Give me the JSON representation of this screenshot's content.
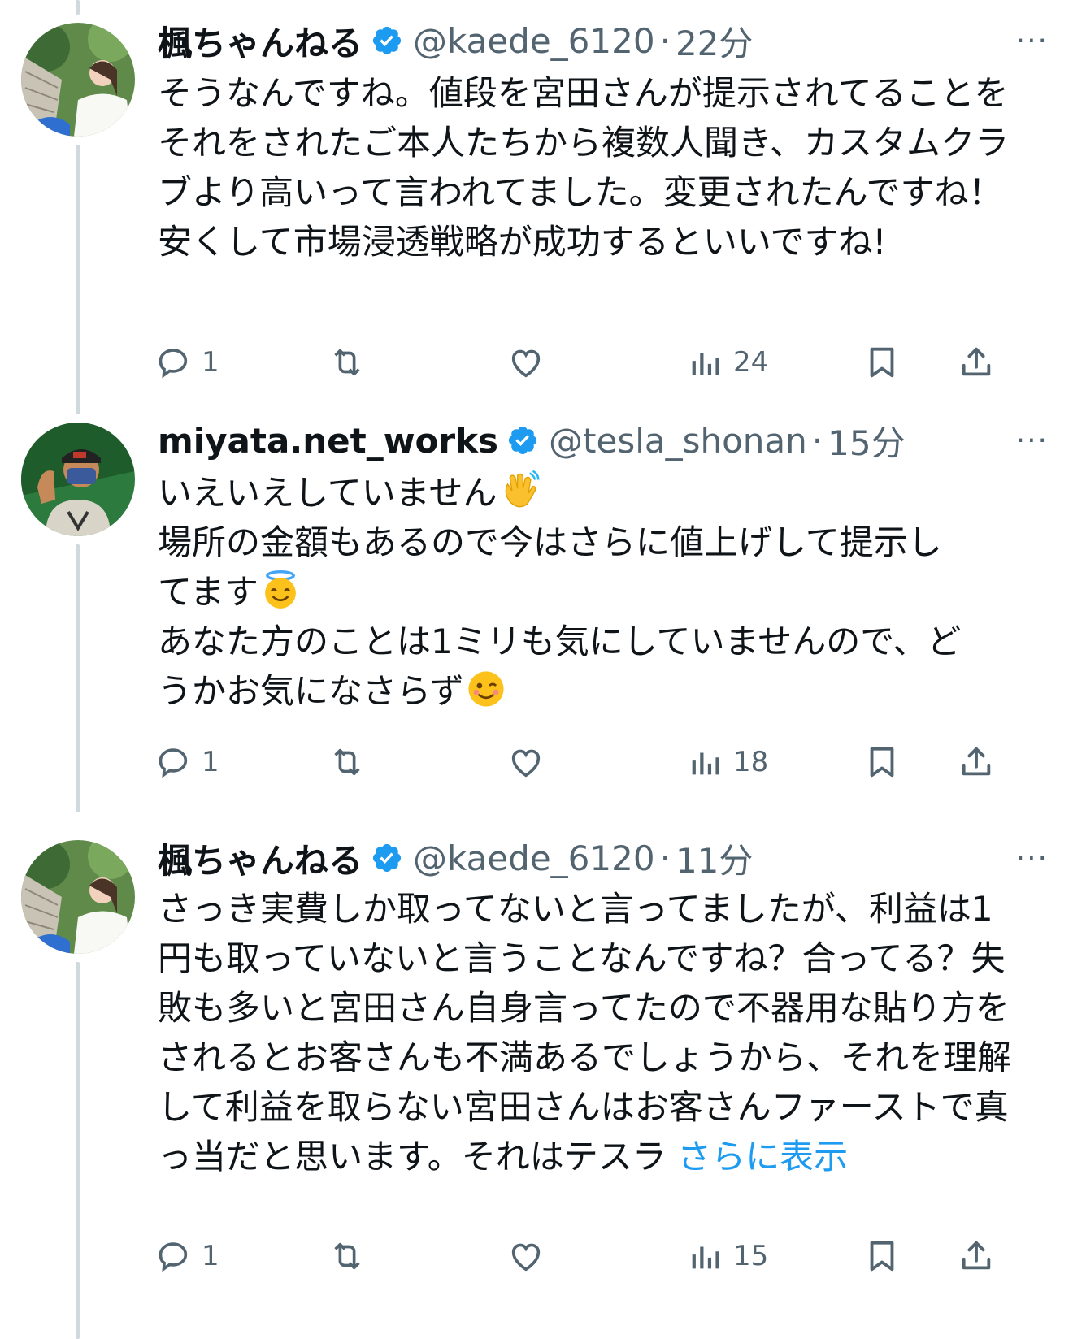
{
  "tweets": [
    {
      "name": "楓ちゃんねる",
      "handle": "@kaede_6120",
      "sep": "·",
      "time": "22分",
      "text": "そうなんですね。値段を宮田さんが提示されてることをそれをされたご本人たちから複数人聞き、カスタムクラブより高いって言われてました。変更されたんですね！安くして市場浸透戦略が成功するといいですね!",
      "replies": "1",
      "views": "24",
      "avatar": "woman-in-garden"
    },
    {
      "name": "miyata.net_works",
      "handle": "@tesla_shonan",
      "sep": "·",
      "time": "15分",
      "lines": [
        "いえいえしていません",
        "場所の金額もあるので今はさらに値上げして提示し",
        "てます",
        "あなた方のことは1ミリも気にしていませんので、ど",
        "うかお気になさらず"
      ],
      "emojis": [
        "waving-hand",
        "smiling-face-with-halo",
        "winking-face"
      ],
      "replies": "1",
      "views": "18",
      "avatar": "masked-man-cartoon"
    },
    {
      "name": "楓ちゃんねる",
      "handle": "@kaede_6120",
      "sep": "·",
      "time": "11分",
      "text": "さっき実費しか取ってないと言ってましたが、利益は1円も取っていないと言うことなんですね？合ってる？失敗も多いと宮田さん自身言ってたので不器用な貼り方をされるとお客さんも不満あるでしょうから、それを理解して利益を取らない宮田さんはお客さんファーストで真っ当だと思います。それはテスラ",
      "show_more": "さらに表示",
      "replies": "1",
      "views": "15",
      "avatar": "woman-in-garden"
    }
  ],
  "more_menu": "···",
  "colors": {
    "accent": "#1d9bf0",
    "secondary": "#536471",
    "thread": "#cfd9de"
  }
}
